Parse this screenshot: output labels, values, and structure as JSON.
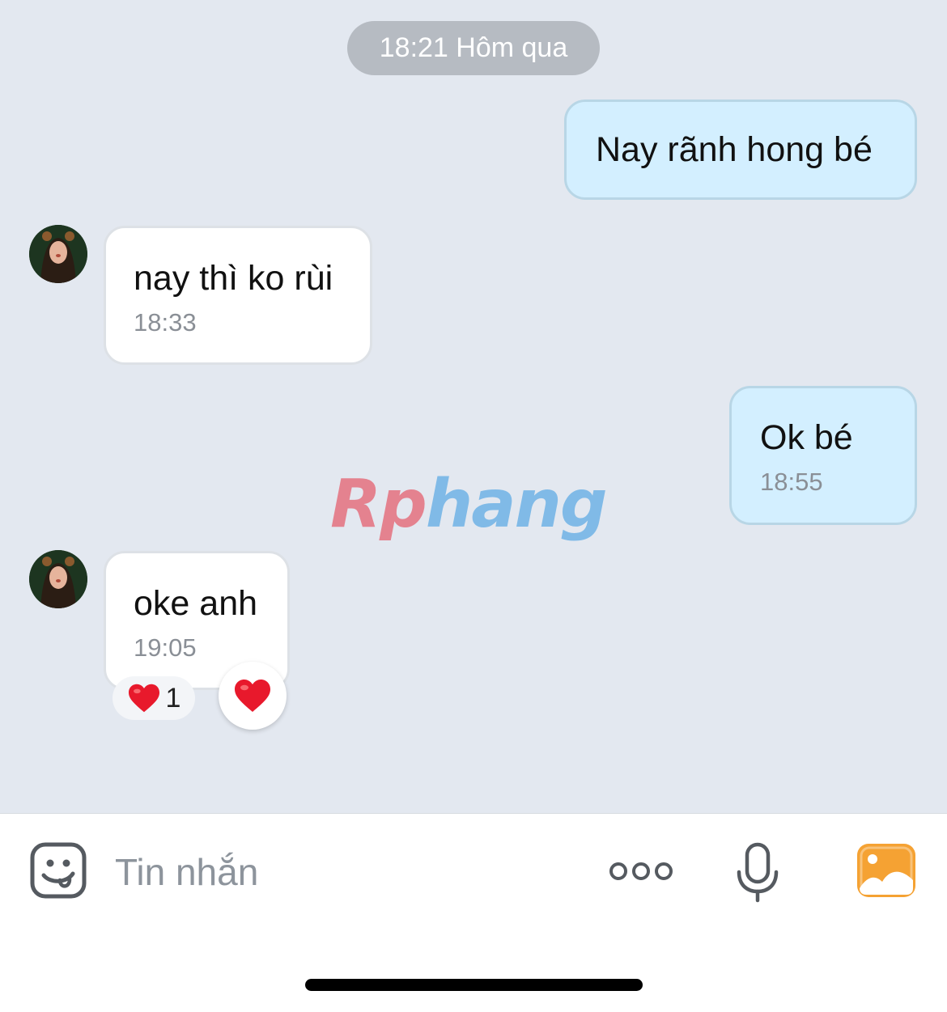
{
  "chat": {
    "date_separator": "18:21 Hôm qua",
    "messages": [
      {
        "sender": "me",
        "text": "Nay rãnh hong bé"
      },
      {
        "sender": "them",
        "text": "nay thì ko rùi",
        "time": "18:33"
      },
      {
        "sender": "me",
        "text": "Ok bé",
        "time": "18:55"
      },
      {
        "sender": "them",
        "text": "oke anh",
        "time": "19:05",
        "reaction": {
          "icon": "heart-icon",
          "count": "1"
        }
      }
    ]
  },
  "watermark": {
    "part1": "Rp",
    "part2": "hang"
  },
  "input": {
    "placeholder": "Tin nhắn"
  },
  "icons": {
    "emoji": "emoji-sticker-icon",
    "more": "more-dots-icon",
    "mic": "microphone-icon",
    "gallery": "photo-gallery-icon"
  },
  "colors": {
    "my_bubble": "#d3efff",
    "their_bubble": "#ffffff",
    "background": "#e3e8f0",
    "gallery_orange": "#f5a233",
    "heart_red": "#e8192c"
  }
}
